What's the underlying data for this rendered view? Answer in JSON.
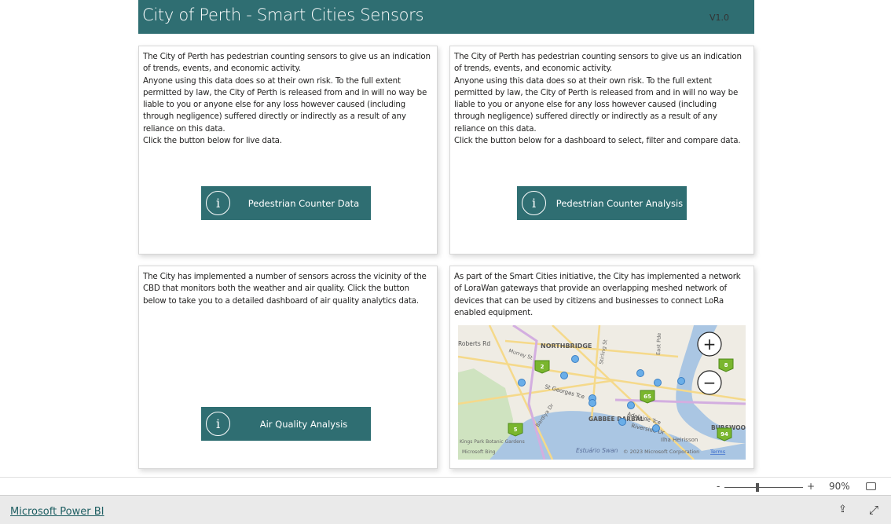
{
  "header": {
    "title": "City of Perth - Smart Cities Sensors",
    "version": "V1.0"
  },
  "cards": [
    {
      "text": "The City of Perth has pedestrian counting sensors to give us an indication of trends, events, and economic activity.\nAnyone using this data does so at their own risk.  To the full extent permitted by law, the City of Perth is released from and in will no way be liable to you or anyone else for any loss however caused (including through negligence) suffered directly or indirectly as a result of any reliance on this data.\nClick the button below for live data.",
      "button": "Pedestrian Counter Data"
    },
    {
      "text": "The City of Perth has pedestrian counting sensors to give us an indication of trends, events, and economic activity.\nAnyone using this data does so at their own risk.  To the full extent permitted by law, the City of Perth is released from and in will no way be liable to you or anyone else for any loss however caused (including through negligence) suffered directly or indirectly as a result of any reliance on this data.\nClick the button below for a dashboard to select, filter and compare data.",
      "button": "Pedestrian Counter Analysis"
    },
    {
      "text": "The City has implemented a number of sensors across the vicinity of the CBD that monitors both the weather and air quality. Click the button below to take you to a detailed dashboard of air quality analytics data.",
      "button": "Air Quality Analysis"
    },
    {
      "text": "As part of the Smart Cities initiative, the City has implemented a network of LoraWan gateways that provide an overlapping meshed network of devices that can be used by citizens and businesses to connect LoRa enabled equipment."
    }
  ],
  "map": {
    "labels": [
      "NORTHBRIDGE",
      "St Georges Tce",
      "Adelaide Tce",
      "Riverside Dr",
      "GABBEE DARBAL",
      "Ilha Heirisson",
      "Estuário Swan",
      "BURSWOOD",
      "Roberts Rd",
      "Murray St",
      "Stirling St",
      "East Pde",
      "Bardiya Dr",
      "Kings Park Botanic Gardens"
    ],
    "clusters": [
      "2",
      "65",
      "5",
      "8",
      "94"
    ],
    "attribution": "© 2023 Microsoft Corporation",
    "terms": "Terms",
    "bing": "Microsoft Bing",
    "zoom_in": "+",
    "zoom_out": "−"
  },
  "status": {
    "minus": "-",
    "plus": "+",
    "zoom": "90%",
    "zoom_level": 0.42
  },
  "bottom": {
    "brand": "Microsoft Power BI"
  },
  "colors": {
    "accent": "#2f6e72",
    "water": "#aac6e3",
    "marker": "#6aaee8",
    "cluster": "#7ab62e"
  }
}
